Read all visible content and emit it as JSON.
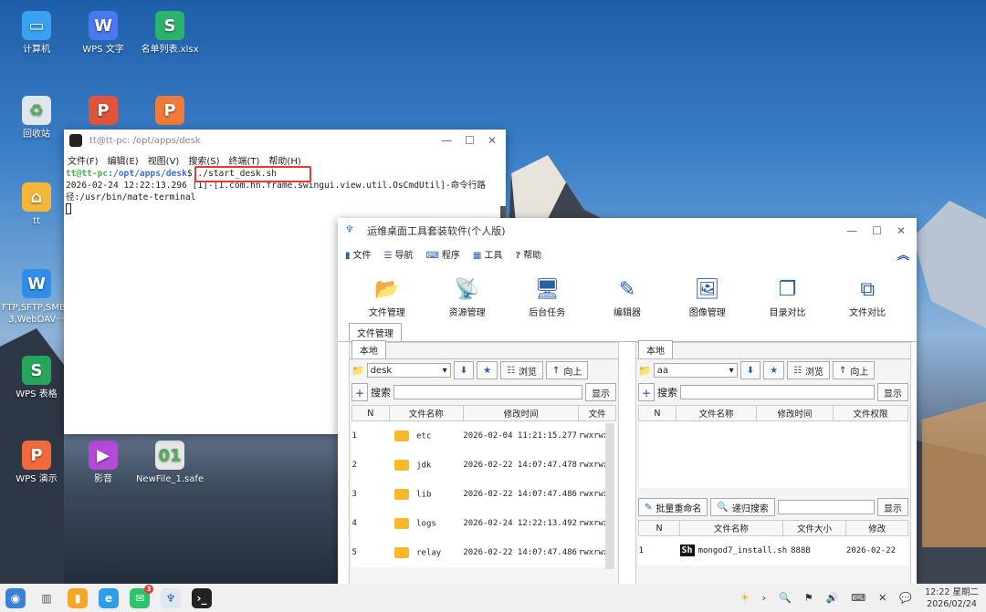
{
  "desktop_icons": [
    {
      "label": "计算机",
      "color": "#3aa0f0",
      "glyph": "▭"
    },
    {
      "label": "WPS 文字",
      "color": "#4a78f0",
      "glyph": "W"
    },
    {
      "label": "名单列表.xlsx",
      "color": "#2ab36b",
      "glyph": "S"
    },
    {
      "label": "回收站",
      "color": "#dfe6ee",
      "glyph": "♻"
    },
    {
      "label": "",
      "color": "#e0553a",
      "glyph": "P"
    },
    {
      "label": "",
      "color": "#f07a3a",
      "glyph": "P"
    },
    {
      "label": "tt",
      "color": "#f5b73a",
      "glyph": "⌂"
    },
    {
      "label": "FTP,SFTP,SMBS3,WebDAV···",
      "color": "#2f8fe8",
      "glyph": "W"
    },
    {
      "label": "WPS 表格",
      "color": "#26a65b",
      "glyph": "S"
    },
    {
      "label": "WPS 演示",
      "color": "#f06a3a",
      "glyph": "P"
    },
    {
      "label": "影音",
      "color": "#b34ad8",
      "glyph": "▶"
    },
    {
      "label": "NewFile_1.safe",
      "color": "#e6e6e6",
      "glyph": "01"
    }
  ],
  "terminal": {
    "title": "tt@tt-pc: /opt/apps/desk",
    "menu": [
      "文件(F)",
      "编辑(E)",
      "视图(V)",
      "搜索(S)",
      "终端(T)",
      "帮助(H)"
    ],
    "prompt_user": "tt@tt-pc",
    "prompt_path": ":/opt/apps/desk",
    "prompt_symbol": "$",
    "command": " ./start_desk.sh",
    "log_line1": "2026-02-24 12:22:13.296 [1]-[1.com.hn.frame.swingui.view.util.OsCmdUtil]-命令行路",
    "log_line2": "径:/usr/bin/mate-terminal"
  },
  "ops": {
    "title": "运维桌面工具套装软件(个人版)",
    "menu": [
      {
        "icon": "file-icon",
        "label": "文件",
        "glyph": "▮"
      },
      {
        "icon": "nav-icon",
        "label": "导航",
        "glyph": "☰"
      },
      {
        "icon": "keyboard-icon",
        "label": "程序",
        "glyph": "⌨"
      },
      {
        "icon": "toolbox-icon",
        "label": "工具",
        "glyph": "▦"
      },
      {
        "icon": "help-icon",
        "label": "帮助",
        "glyph": "?"
      }
    ],
    "toolbar": [
      {
        "label": "文件管理",
        "glyph": "📂",
        "icon": "folder-open-icon"
      },
      {
        "label": "资源管理",
        "glyph": "📡",
        "icon": "satellite-icon"
      },
      {
        "label": "后台任务",
        "glyph": "🖥",
        "icon": "monitor-icon"
      },
      {
        "label": "编辑器",
        "glyph": "✎",
        "icon": "edit-icon"
      },
      {
        "label": "图像管理",
        "glyph": "🖼",
        "icon": "image-icon"
      },
      {
        "label": "目录对比",
        "glyph": "❐",
        "icon": "dir-compare-icon"
      },
      {
        "label": "文件对比",
        "glyph": "⧉",
        "icon": "file-compare-icon"
      }
    ],
    "main_tab": "文件管理",
    "left": {
      "tab": "本地",
      "folder": "desk",
      "browse": "浏览",
      "up": "向上",
      "search_label": "搜索",
      "show": "显示",
      "columns": [
        "N",
        "文件名称",
        "修改时间",
        "文件"
      ],
      "rows": [
        {
          "n": "1",
          "name": "etc",
          "time": "2026-02-04 11:21:15.277",
          "perm": "rwxrwxr"
        },
        {
          "n": "2",
          "name": "jdk",
          "time": "2026-02-22 14:07:47.478",
          "perm": "rwxrwxr"
        },
        {
          "n": "3",
          "name": "lib",
          "time": "2026-02-22 14:07:47.486",
          "perm": "rwxrwxr"
        },
        {
          "n": "4",
          "name": "logs",
          "time": "2026-02-24 12:22:13.492",
          "perm": "rwxrwxr"
        },
        {
          "n": "5",
          "name": "relay",
          "time": "2026-02-22 14:07:47.486",
          "perm": "rwxrwxr"
        }
      ]
    },
    "right": {
      "tab": "本地",
      "folder": "aa",
      "browse": "浏览",
      "up": "向上",
      "search_label": "搜索",
      "show": "显示",
      "columns": [
        "N",
        "文件名称",
        "修改时间",
        "文件权限"
      ],
      "batch_rename": "批量重命名",
      "recursive_search": "递归搜索",
      "show2": "显示",
      "columns2": [
        "N",
        "文件名称",
        "文件大小",
        "修改"
      ],
      "rows2": [
        {
          "n": "1",
          "icon": "Sh",
          "name": "mongod7_install.sh",
          "size": "888B",
          "time": "2026-02-22"
        }
      ]
    }
  },
  "taskbar": {
    "clock_time": "12:22 星期二",
    "clock_date": "2026/02/24",
    "badge": "3"
  }
}
